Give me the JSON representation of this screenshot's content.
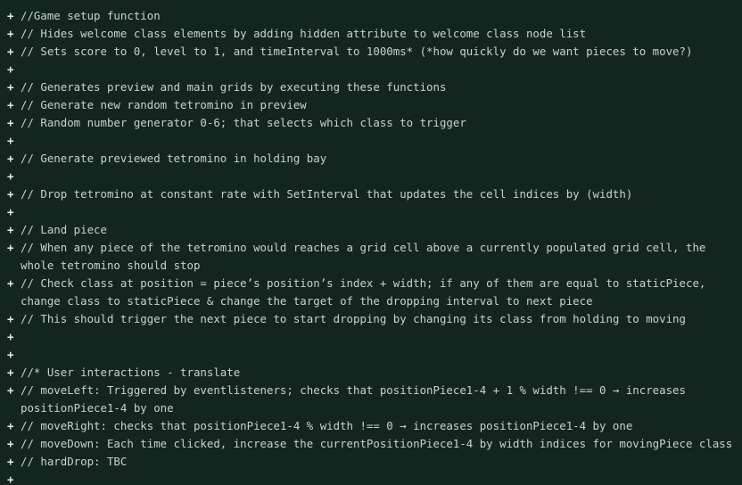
{
  "diff": {
    "marker": "+",
    "lines": [
      "//Game setup function",
      "// Hides welcome class elements by adding hidden attribute to welcome class node list",
      "// Sets score to 0, level to 1, and timeInterval to 1000ms* (*how quickly do we want pieces to move?)",
      "",
      "// Generates preview and main grids by executing these functions",
      "// Generate new random tetromino in preview",
      "// Random number generator 0-6; that selects which class to trigger",
      "",
      "// Generate previewed tetromino in holding bay",
      "",
      "// Drop tetromino at constant rate with SetInterval that updates the cell indices by (width)",
      "",
      "// Land piece",
      "// When any piece of the tetromino would reaches a grid cell above a currently populated grid cell, the whole tetromino should stop",
      "// Check class at position = piece’s position’s index + width; if any of them are equal to staticPiece, change class to staticPiece & change the target of the dropping interval to next piece",
      "// This should trigger the next piece to start dropping by changing its class from holding to moving",
      "",
      "",
      "//* User interactions - translate",
      "// moveLeft: Triggered by eventlisteners; checks that positionPiece1-4 + 1 % width !== 0 → increases positionPiece1-4 by one",
      "// moveRight: checks that positionPiece1-4 % width !== 0 → increases positionPiece1-4 by one",
      "// moveDown: Each time clicked, increase the currentPositionPiece1-4 by width indices for movingPiece class",
      "// hardDrop: TBC",
      ""
    ]
  }
}
